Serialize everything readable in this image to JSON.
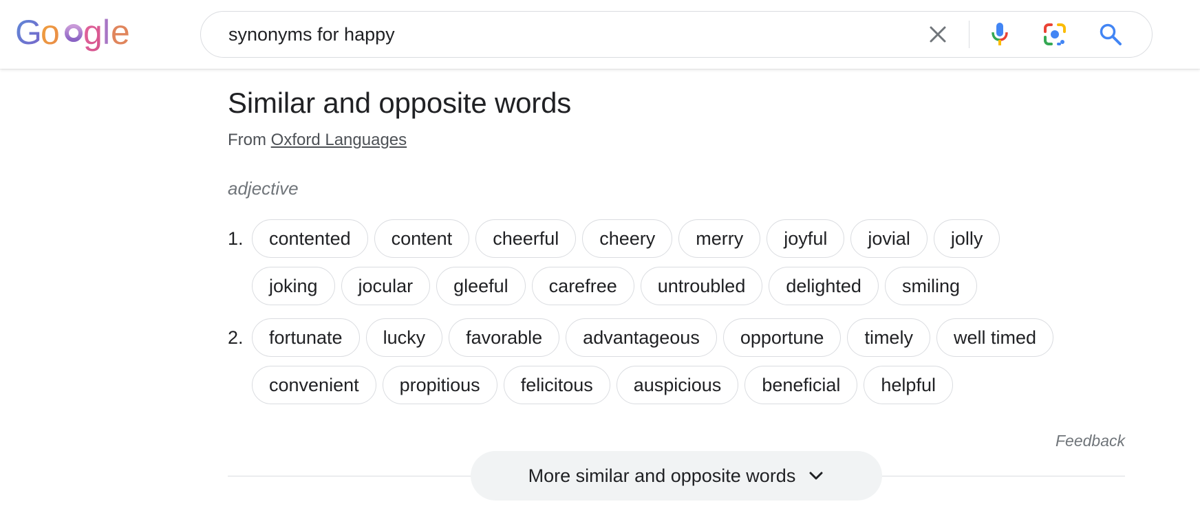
{
  "header": {
    "logo_text": "Google",
    "search": {
      "value": "synonyms for happy",
      "clear_icon": "close-icon",
      "mic_icon": "microphone-icon",
      "lens_icon": "google-lens-icon",
      "search_icon": "search-icon"
    }
  },
  "panel": {
    "title": "Similar and opposite words",
    "source_prefix": "From",
    "source_link": "Oxford Languages",
    "part_of_speech": "adjective",
    "senses": [
      {
        "number": "1.",
        "rows": [
          [
            "contented",
            "content",
            "cheerful",
            "cheery",
            "merry",
            "joyful",
            "jovial",
            "jolly"
          ],
          [
            "joking",
            "jocular",
            "gleeful",
            "carefree",
            "untroubled",
            "delighted",
            "smiling"
          ]
        ]
      },
      {
        "number": "2.",
        "rows": [
          [
            "fortunate",
            "lucky",
            "favorable",
            "advantageous",
            "opportune",
            "timely",
            "well timed"
          ],
          [
            "convenient",
            "propitious",
            "felicitous",
            "auspicious",
            "beneficial",
            "helpful"
          ]
        ]
      }
    ],
    "feedback": "Feedback",
    "more_button": "More similar and opposite words",
    "more_icon": "chevron-down-icon"
  },
  "colors": {
    "google_blue": "#4285F4",
    "google_red": "#EA4335",
    "google_yellow": "#FBBC05",
    "google_green": "#34A853",
    "text": "#202124",
    "muted": "#70757a",
    "chip_border": "#dadce0",
    "more_button_bg": "#f1f3f4"
  }
}
